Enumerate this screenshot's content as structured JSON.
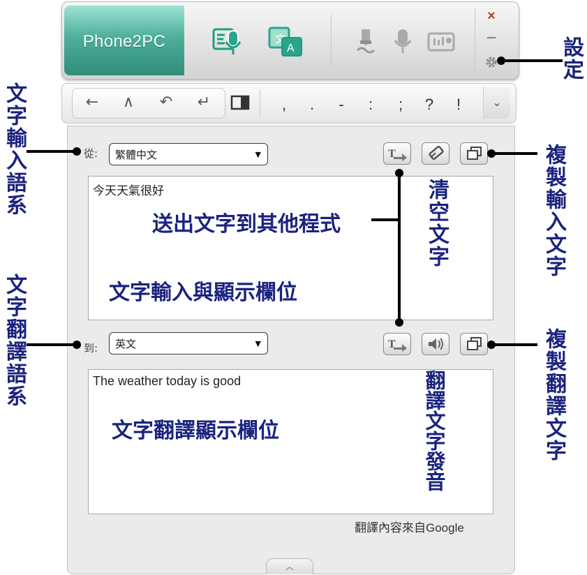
{
  "app": {
    "title": "Phone2PC",
    "window_controls": {
      "close": "×",
      "minimize": "—"
    }
  },
  "icons": {
    "speech": "microphone-speech-icon",
    "translate": "translate-icon",
    "pen": "pen-icon",
    "mic": "microphone-icon",
    "keyboard": "keyboard-icon",
    "settings": "gear-icon"
  },
  "toolbar": {
    "nav": [
      "←",
      "∧",
      "↶",
      "↵"
    ],
    "punctuation": [
      ",",
      ".",
      "-",
      ":",
      ";",
      "?",
      "!"
    ],
    "more": "⌄"
  },
  "input": {
    "label": "從:",
    "language": "繁體中文",
    "text": "今天天氣很好"
  },
  "output": {
    "label": "到:",
    "language": "英文",
    "text": "The weather today is good"
  },
  "footer": {
    "source_note": "翻譯內容來自Google",
    "collapse": "︿"
  },
  "annotations": {
    "settings": "設定",
    "input_language": "文字輸入語系",
    "translate_language": "文字翻譯語系",
    "send_text": "送出文字到其他程式",
    "clear_text": "清空文字",
    "copy_input": "複製輸入文字",
    "copy_translation": "複製翻譯文字",
    "input_field": "文字輸入與顯示欄位",
    "translation_field": "文字翻譯顯示欄位",
    "speak_translation": "翻譯文字發音"
  },
  "colors": {
    "accent": "#3aa48f",
    "annotation": "#1a237e",
    "close": "#c0392b"
  }
}
